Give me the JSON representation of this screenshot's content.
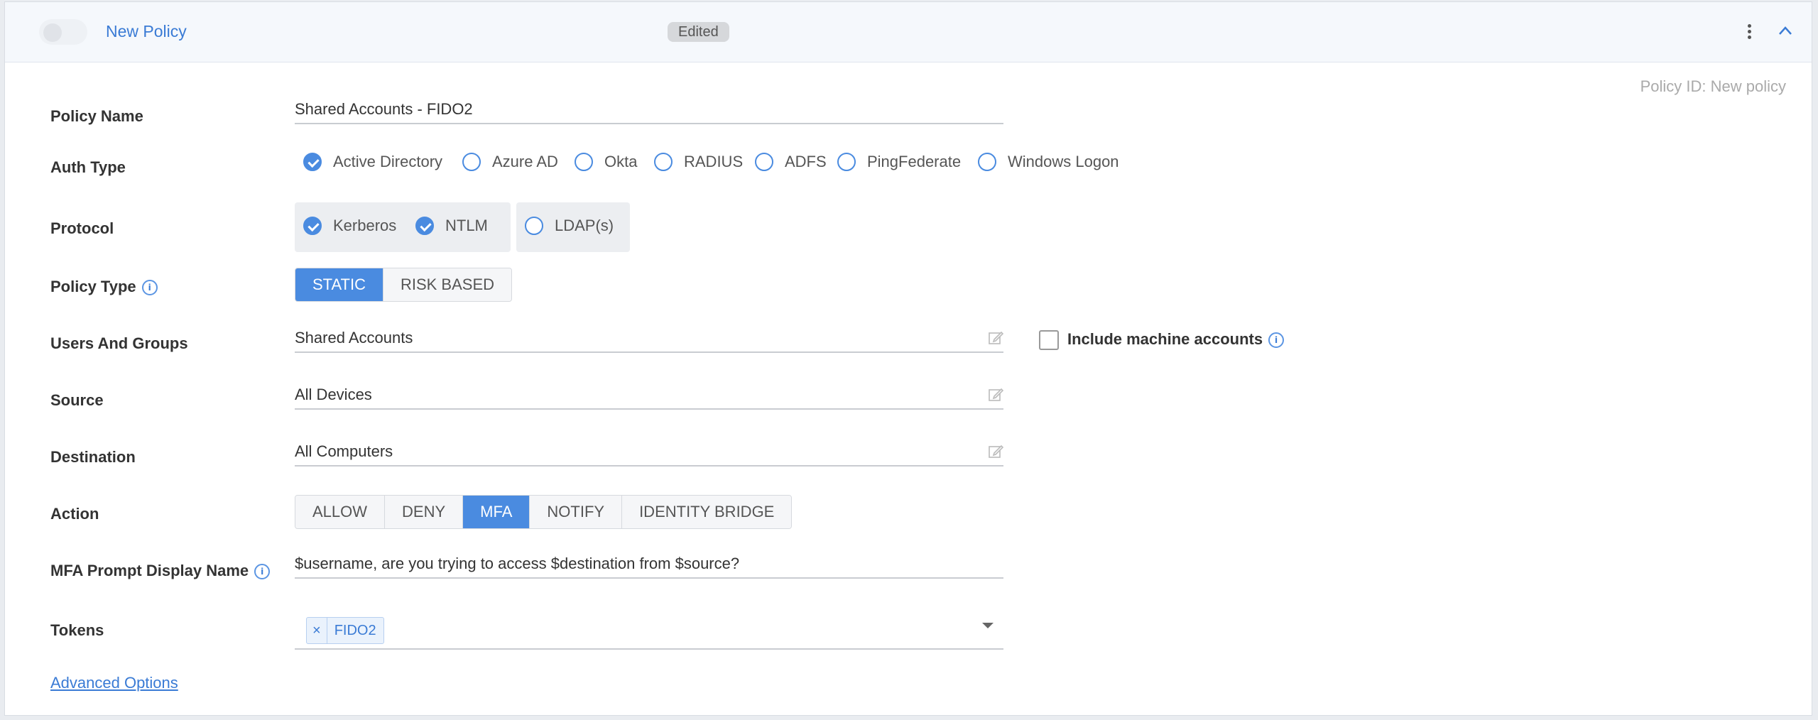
{
  "header": {
    "title": "New Policy",
    "status_badge": "Edited",
    "toggle_enabled": false
  },
  "policy_id": "Policy ID: New policy",
  "fields": {
    "policy_name": {
      "label": "Policy Name",
      "value": "Shared Accounts - FIDO2"
    },
    "auth_type": {
      "label": "Auth Type",
      "options": [
        {
          "label": "Active Directory",
          "checked": true
        },
        {
          "label": "Azure AD",
          "checked": false
        },
        {
          "label": "Okta",
          "checked": false
        },
        {
          "label": "RADIUS",
          "checked": false
        },
        {
          "label": "ADFS",
          "checked": false
        },
        {
          "label": "PingFederate",
          "checked": false
        },
        {
          "label": "Windows Logon",
          "checked": false
        }
      ]
    },
    "protocol": {
      "label": "Protocol",
      "options": [
        {
          "label": "Kerberos",
          "checked": true
        },
        {
          "label": "NTLM",
          "checked": true
        },
        {
          "label": "LDAP(s)",
          "checked": false
        }
      ]
    },
    "policy_type": {
      "label": "Policy Type",
      "options": [
        {
          "label": "STATIC",
          "active": true
        },
        {
          "label": "RISK BASED",
          "active": false
        }
      ]
    },
    "users_and_groups": {
      "label": "Users And Groups",
      "value": "Shared Accounts",
      "include_machine_accounts": {
        "label": "Include machine accounts",
        "checked": false
      }
    },
    "source": {
      "label": "Source",
      "value": "All Devices"
    },
    "destination": {
      "label": "Destination",
      "value": "All Computers"
    },
    "action": {
      "label": "Action",
      "options": [
        {
          "label": "ALLOW",
          "active": false
        },
        {
          "label": "DENY",
          "active": false
        },
        {
          "label": "MFA",
          "active": true
        },
        {
          "label": "NOTIFY",
          "active": false
        },
        {
          "label": "IDENTITY BRIDGE",
          "active": false
        }
      ]
    },
    "mfa_prompt": {
      "label": "MFA Prompt Display Name",
      "value": "$username, are you trying to access $destination from $source?"
    },
    "tokens": {
      "label": "Tokens",
      "chips": [
        {
          "remove": "×",
          "label": "FIDO2"
        }
      ]
    }
  },
  "advanced_options": "Advanced Options",
  "colors": {
    "accent": "#4a8be0",
    "link": "#3a7bd5"
  },
  "icons": {
    "info": "info-icon",
    "edit": "edit-icon",
    "more": "more-vertical-icon",
    "collapse": "chevron-up-icon",
    "dropdown": "caret-down-icon"
  }
}
